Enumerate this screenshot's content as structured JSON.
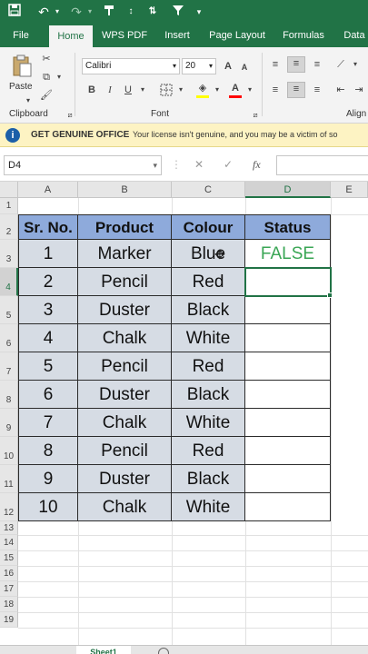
{
  "quick_access": {
    "icons": [
      "save-icon",
      "undo-icon",
      "redo-icon",
      "format-painter-icon",
      "sort-icon",
      "filter-icon",
      "more-icon"
    ]
  },
  "tabs": [
    {
      "label": "File"
    },
    {
      "label": "Home",
      "active": true
    },
    {
      "label": "WPS PDF"
    },
    {
      "label": "Insert"
    },
    {
      "label": "Page Layout"
    },
    {
      "label": "Formulas"
    },
    {
      "label": "Data"
    }
  ],
  "ribbon": {
    "clipboard": {
      "paste_label": "Paste",
      "group_label": "Clipboard"
    },
    "font": {
      "name": "Calibri",
      "size": "20",
      "bold": "B",
      "italic": "I",
      "underline": "U",
      "font_color": "A",
      "group_label": "Font"
    },
    "alignment": {
      "group_label": "Align"
    },
    "colors": {
      "accent": "#217346",
      "highlight": "#ffff00",
      "font_color_bar": "#ff0000"
    }
  },
  "message_bar": {
    "title": "GET GENUINE OFFICE",
    "text": "Your license isn't genuine, and you may be a victim of so"
  },
  "formula_bar": {
    "name_box": "D4",
    "fx_label": "fx",
    "value": ""
  },
  "columns": [
    "A",
    "B",
    "C",
    "D",
    "E"
  ],
  "rows": [
    "1",
    "2",
    "3",
    "4",
    "5",
    "6",
    "7",
    "8",
    "9",
    "10",
    "11",
    "12",
    "13",
    "14",
    "15",
    "16",
    "17",
    "18",
    "19"
  ],
  "selected_cell": "D4",
  "table": {
    "headers": [
      "Sr. No.",
      "Product",
      "Colour",
      "Status"
    ],
    "rows": [
      [
        "1",
        "Marker",
        "Blue",
        "FALSE"
      ],
      [
        "2",
        "Pencil",
        "Red",
        ""
      ],
      [
        "3",
        "Duster",
        "Black",
        ""
      ],
      [
        "4",
        "Chalk",
        "White",
        ""
      ],
      [
        "5",
        "Pencil",
        "Red",
        ""
      ],
      [
        "6",
        "Duster",
        "Black",
        ""
      ],
      [
        "7",
        "Chalk",
        "White",
        ""
      ],
      [
        "8",
        "Pencil",
        "Red",
        ""
      ],
      [
        "9",
        "Duster",
        "Black",
        ""
      ],
      [
        "10",
        "Chalk",
        "White",
        ""
      ]
    ],
    "colors": {
      "header_fill": "#8eaadb",
      "data_fill": "#d6dce4",
      "false_text": "#3aa655"
    }
  },
  "sheet_tabs": [
    {
      "label": "Sheet1"
    }
  ]
}
